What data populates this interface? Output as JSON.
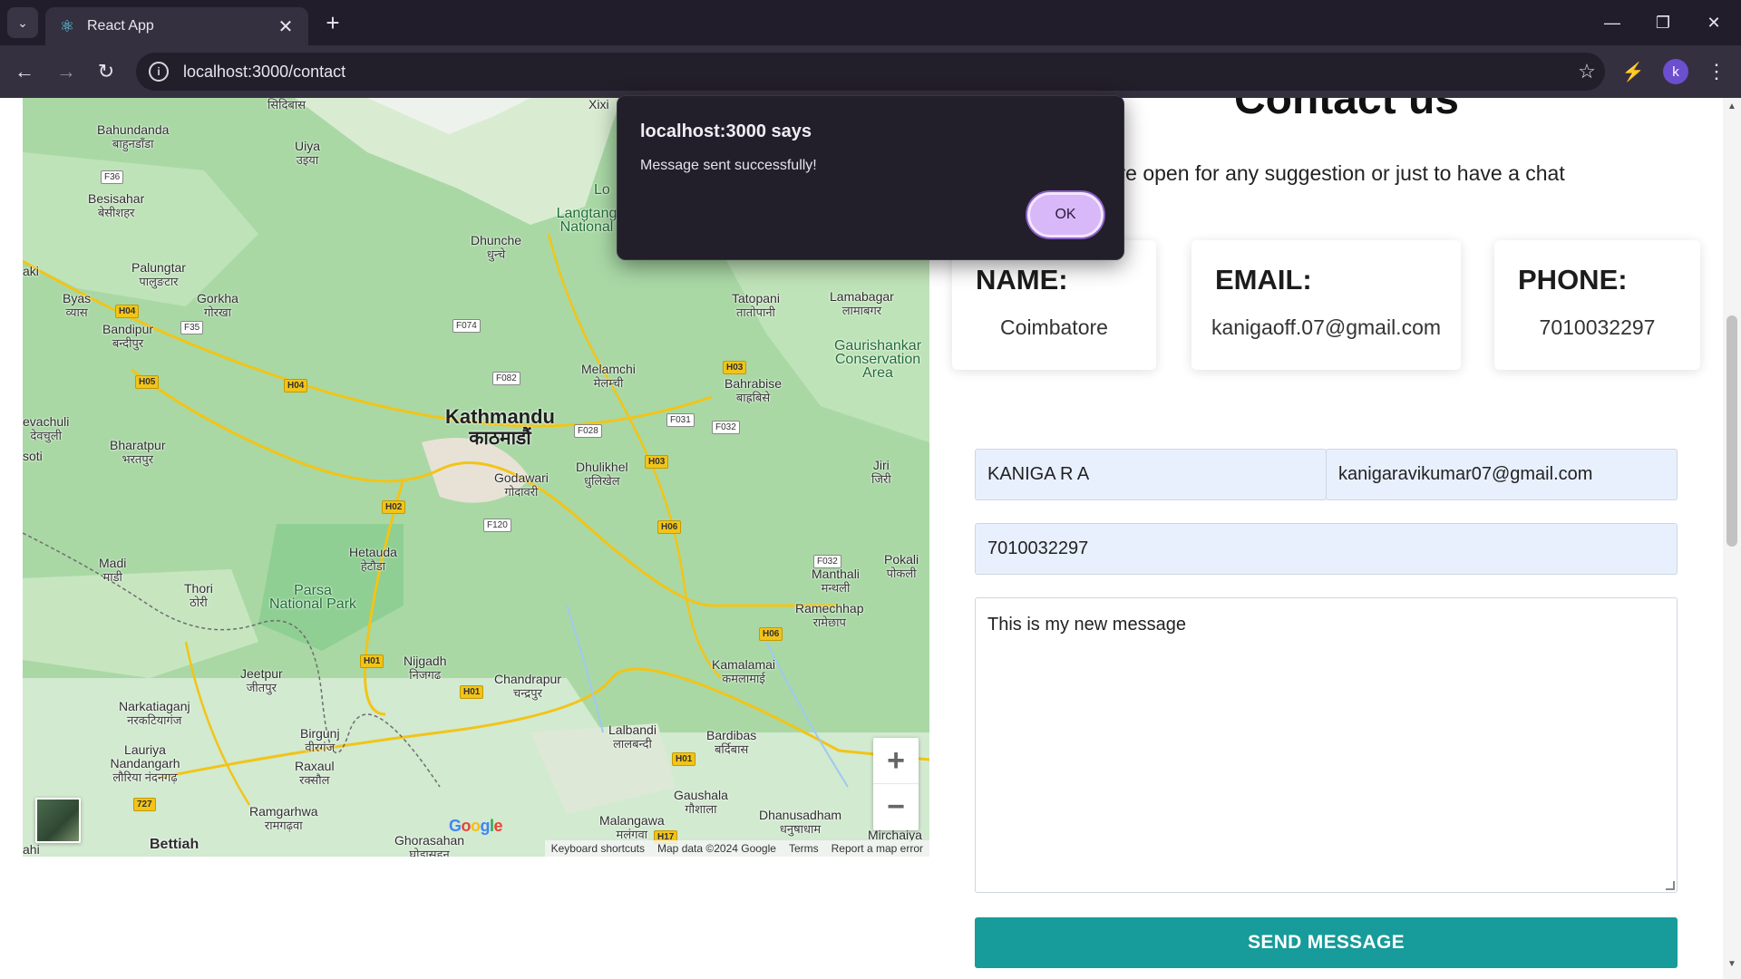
{
  "browser": {
    "tab_title": "React App",
    "url": "localhost:3000/contact",
    "profile_initial": "k",
    "new_tab_symbol": "+",
    "close_symbol": "✕",
    "icons": [
      "tab-list-icon",
      "react-logo-icon",
      "back-arrow-icon",
      "forward-arrow-icon",
      "reload-icon",
      "site-info-icon",
      "bookmark-star-icon",
      "extensions-icon",
      "more-menu-icon",
      "minimize-icon",
      "restore-icon",
      "close-icon"
    ]
  },
  "page": {
    "title": "Contact us",
    "subtitle": "We're open for any suggestion or just to have a chat",
    "info_cards": [
      {
        "label": "NAME:",
        "value": "Coimbatore"
      },
      {
        "label": "EMAIL:",
        "value": "kanigaoff.07@gmail.com"
      },
      {
        "label": "PHONE:",
        "value": "7010032297"
      }
    ],
    "form": {
      "name_value": "KANIGA R A",
      "email_value": "kanigaravikumar07@gmail.com",
      "phone_value": "7010032297",
      "message_value": "This is my new message",
      "send_label": "SEND MESSAGE"
    }
  },
  "map": {
    "labels": {
      "kathmandu": "Kathmandu",
      "kathmandu_dev": "काठमाडौं",
      "bahundanda": "Bahundanda",
      "bahundanda_dev": "बाहुनडाँडा",
      "siruibas_dev": "सिदिबास",
      "uiya": "Uiya",
      "uiya_dev": "उइया",
      "besisahar": "Besisahar",
      "besisahar_dev": "बेसीशहर",
      "palungtar": "Palungtar",
      "palungtar_dev": "पालुङटार",
      "gorkha": "Gorkha",
      "gorkha_dev": "गोरखा",
      "byas": "Byas",
      "byas_dev": "व्यास",
      "bandipur": "Bandipur",
      "bandipur_dev": "बन्दीपुर",
      "dhunche": "Dhunche",
      "dhunche_dev": "धुन्चे",
      "langtang": "Langtang National",
      "tatopani": "Tatopani",
      "tatopani_dev": "तातोपानी",
      "lamabagar": "Lamabagar",
      "lamabagar_dev": "लामाबगर",
      "melamchi": "Melamchi",
      "melamchi_dev": "मेलम्ची",
      "bahrabise": "Bahrabise",
      "bahrabise_dev": "बाह्रबिसे",
      "gaurishankar": "Gaurishankar Conservation Area",
      "bharatpur": "Bharatpur",
      "bharatpur_dev": "भरतपुर",
      "evachuli": "evachuli",
      "evachuli_dev": "देवचुली",
      "godawari": "Godawari",
      "godawari_dev": "गोदावरी",
      "dhulikhel": "Dhulikhel",
      "dhulikhel_dev": "धुलिखेल",
      "jiri": "Jiri",
      "jiri_dev": "जिरी",
      "hetauda": "Hetauda",
      "hetauda_dev": "हेटौडा",
      "madi": "Madi",
      "madi_dev": "माडी",
      "thori": "Thori",
      "thori_dev": "ठोरी",
      "parsa": "Parsa National Park",
      "manthali": "Manthali",
      "manthali_dev": "मन्थली",
      "pokali": "Pokali",
      "pokali_dev": "पोकली",
      "ramechhap": "Ramechhap",
      "ramechhap_dev": "रामेछाप",
      "nijgadh": "Nijgadh",
      "nijgadh_dev": "निजगढ",
      "chandrapur": "Chandrapur",
      "chandrapur_dev": "चन्द्रपुर",
      "kamalamai": "Kamalamai",
      "kamalamai_dev": "कमलामाई",
      "jeetpur": "Jeetpur",
      "jeetpur_dev": "जीतपुर",
      "narkatiaganj": "Narkatiaganj",
      "narkatiaganj_dev": "नरकटियागंज",
      "lauriya": "Lauriya Nandangarh",
      "lauriya_dev": "लौरिया नंदनगढ़",
      "birgunj": "Birgunj",
      "birgunj_dev": "वीरगंज",
      "raxaul": "Raxaul",
      "raxaul_dev": "रक्सौल",
      "ramgarhwa": "Ramgarhwa",
      "ramgarhwa_dev": "रामगढ़वा",
      "ghorasahan": "Ghorasahan",
      "ghorasahan_dev": "घोड़ासहन",
      "lalbandi": "Lalbandi",
      "lalbandi_dev": "लालबन्दी",
      "bardibas": "Bardibas",
      "bardibas_dev": "बर्दिबास",
      "gaushala": "Gaushala",
      "gaushala_dev": "गौशाला",
      "malangawa": "Malangawa",
      "malangawa_dev": "मलंगवा",
      "dhanusadham": "Dhanusadham",
      "dhanusadham_dev": "धनुषाधाम",
      "mirchaiya": "Mirchaiya",
      "bettiah": "Bettiah",
      "xixi": "Xixi",
      "lo": "Lo",
      "soti": "soti",
      "aki": "aki",
      "ahi": "ahi"
    },
    "shields": [
      "F36",
      "H04",
      "F35",
      "H05",
      "H04",
      "F074",
      "F082",
      "H03",
      "F028",
      "F031",
      "F032",
      "H03",
      "H02",
      "F120",
      "H06",
      "F032",
      "H06",
      "H01",
      "H01",
      "H01",
      "727",
      "H17"
    ],
    "zoom_in": "+",
    "zoom_out": "−",
    "google": "Google",
    "footer": [
      "Keyboard shortcuts",
      "Map data ©2024 Google",
      "Terms",
      "Report a map error"
    ]
  },
  "alert": {
    "title": "localhost:3000 says",
    "message": "Message sent successfully!",
    "ok_label": "OK"
  }
}
